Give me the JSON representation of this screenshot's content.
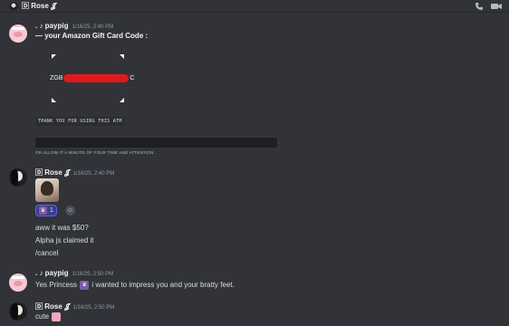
{
  "header": {
    "title": "🄳 Rose 𝓙",
    "call_icon": "phone-icon",
    "video_icon": "video-icon"
  },
  "messages": [
    {
      "username": ". ♪ paypig",
      "timestamp": "1/16/25, 2:40 PM",
      "line1": "— your Amazon Gift Card Code :",
      "code_prefix": "ZGB",
      "code_suffix": "C",
      "atm_text": "THANK YOU FOR USING THIS ATM",
      "allow_text": "OR ALLOW IT A MINUTE OF YOUR TIME AND ATTENTION."
    },
    {
      "username": "🄳 Rose 𝓙",
      "timestamp": "1/16/25, 2:40 PM",
      "reaction_count": "1",
      "lines": [
        "aww it was $50?",
        "Alpha js claimed it",
        "/cancel"
      ]
    },
    {
      "username": ". ♪ paypig",
      "timestamp": "1/16/25, 2:50 PM",
      "text_before": "Yes Princess",
      "text_after": "i wanted to impress you and your bratty feet."
    },
    {
      "username": "🄳 Rose 𝓙",
      "timestamp": "1/16/25, 2:50 PM",
      "text": "cute"
    }
  ]
}
